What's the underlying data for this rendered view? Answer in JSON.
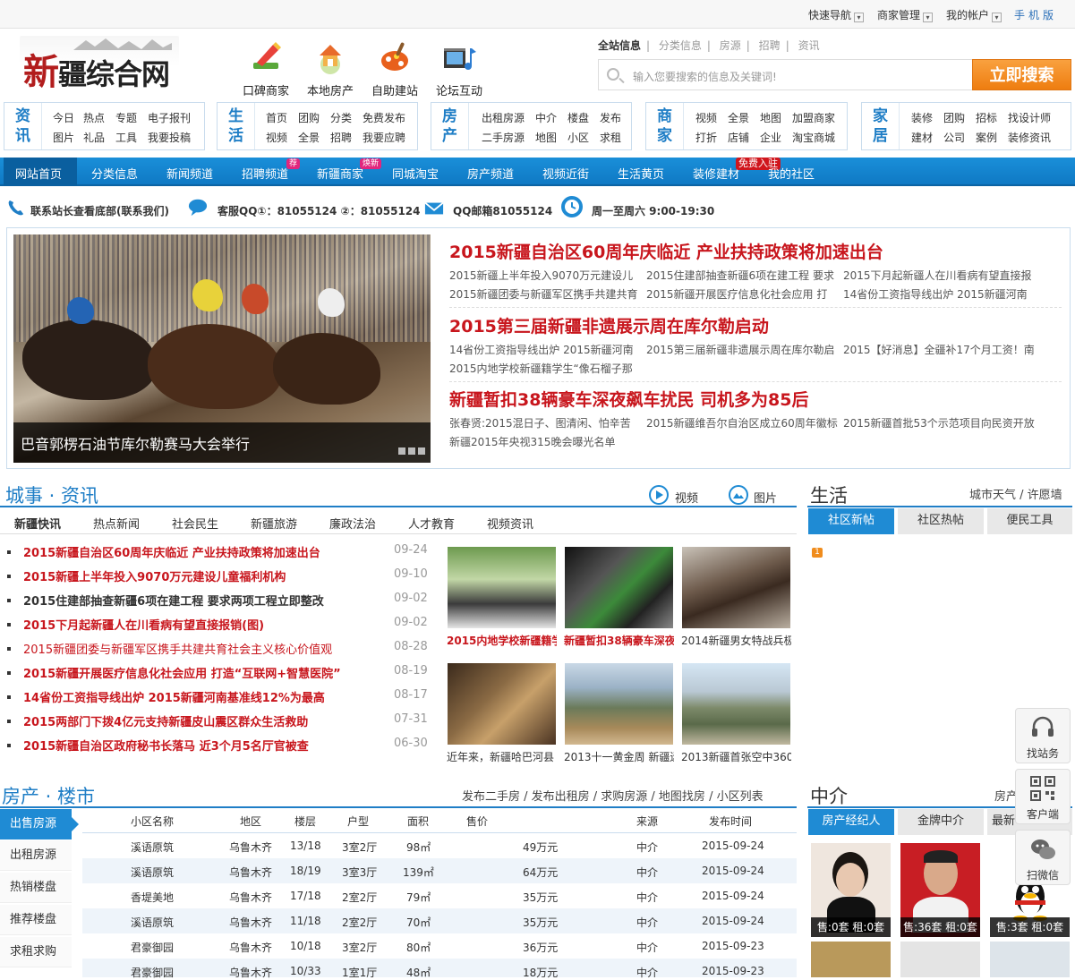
{
  "topbar": {
    "quicknav": "快速导航",
    "merchant": "商家管理",
    "account": "我的帐户",
    "mobile": "手机版"
  },
  "logo": {
    "text_big": "新",
    "text_rest": "疆综合网"
  },
  "header_icons": [
    {
      "label": "口碑商家"
    },
    {
      "label": "本地房产"
    },
    {
      "label": "自助建站"
    },
    {
      "label": "论坛互动"
    }
  ],
  "search": {
    "tabs": [
      "全站信息",
      "分类信息",
      "房源",
      "招聘",
      "资讯"
    ],
    "placeholder": "输入您要搜索的信息及关键词!",
    "button": "立即搜索"
  },
  "categories": [
    {
      "title1": "资",
      "title2": "讯",
      "links": [
        "今日",
        "热点",
        "专题",
        "电子报刊",
        "图片",
        "礼品",
        "工具",
        "我要投稿"
      ]
    },
    {
      "title1": "生",
      "title2": "活",
      "links": [
        "首页",
        "团购",
        "分类",
        "免费发布",
        "视频",
        "全景",
        "招聘",
        "我要应聘"
      ]
    },
    {
      "title1": "房",
      "title2": "产",
      "links": [
        "出租房源",
        "中介",
        "楼盘",
        "发布",
        "二手房源",
        "地图",
        "小区",
        "求租"
      ]
    },
    {
      "title1": "商",
      "title2": "家",
      "links": [
        "视频",
        "全景",
        "地图",
        "加盟商家",
        "打折",
        "店铺",
        "企业",
        "淘宝商城"
      ]
    },
    {
      "title1": "家",
      "title2": "居",
      "links": [
        "装修",
        "团购",
        "招标",
        "找设计师",
        "建材",
        "公司",
        "案例",
        "装修资讯"
      ]
    }
  ],
  "nav": {
    "items": [
      "网站首页",
      "分类信息",
      "新闻频道",
      "招聘频道",
      "新疆商家",
      "同城淘宝",
      "房产频道",
      "视频近街",
      "生活黄页",
      "装修建材",
      "我的社区"
    ],
    "tags": {
      "recommend": "荐",
      "new": "焕新",
      "free": "免费入驻"
    }
  },
  "contact": {
    "stationmaster": "联系站长查看底部(联系我们)",
    "qq": "客服QQ①：81055124 ②：81055124",
    "mail": "QQ邮箱81055124",
    "hours": "周一至周六 9:00-19:30"
  },
  "slider": {
    "caption": "巴音郭楞石油节库尔勒赛马大会举行"
  },
  "headlines": [
    {
      "title": "2015新疆自治区60周年庆临近 产业扶持政策将加速出台",
      "subs": [
        "2015新疆上半年投入9070万元建设儿",
        "2015住建部抽查新疆6项在建工程 要求",
        "2015下月起新疆人在川看病有望直接报",
        "2015新疆团委与新疆军区携手共建共育",
        "2015新疆开展医疗信息化社会应用 打",
        "14省份工资指导线出炉 2015新疆河南"
      ]
    },
    {
      "title": "2015第三届新疆非遗展示周在库尔勒启动",
      "subs": [
        "14省份工资指导线出炉 2015新疆河南",
        "2015第三届新疆非遗展示周在库尔勒启",
        "2015【好消息】全疆补17个月工资！南",
        "2015内地学校新疆籍学生“像石榴子那"
      ]
    },
    {
      "title": "新疆暂扣38辆豪车深夜飙车扰民 司机多为85后",
      "subs": [
        "张春贤:2015混日子、图清闲、怕辛苦",
        "2015新疆维吾尔自治区成立60周年徽标",
        "2015新疆首批53个示范项目向民资开放",
        "新疆2015年央视315晚会曝光名单"
      ]
    }
  ],
  "news_section": {
    "title": "城事 · 资讯",
    "video": "视频",
    "photo": "图片",
    "tabs": [
      "新疆快讯",
      "热点新闻",
      "社会民生",
      "新疆旅游",
      "廉政法治",
      "人才教育",
      "视频资讯"
    ],
    "items": [
      {
        "text": "2015新疆自治区60周年庆临近 产业扶持政策将加速出台",
        "date": "09-24"
      },
      {
        "text": "2015新疆上半年投入9070万元建设儿童福利机构",
        "date": "09-10"
      },
      {
        "text": "2015住建部抽查新疆6项在建工程 要求两项工程立即整改",
        "date": "09-02"
      },
      {
        "text": "2015下月起新疆人在川看病有望直接报销(图)",
        "date": "09-02"
      },
      {
        "text": "2015新疆团委与新疆军区携手共建共育社会主义核心价值观",
        "date": "08-28"
      },
      {
        "text": "2015新疆开展医疗信息化社会应用 打造“互联网+智慧医院”",
        "date": "08-19"
      },
      {
        "text": "14省份工资指导线出炉 2015新疆河南基准线12%为最高",
        "date": "08-17"
      },
      {
        "text": "2015两部门下拨4亿元支持新疆皮山震区群众生活救助",
        "date": "07-31"
      },
      {
        "text": "2015新疆自治区政府秘书长落马 近3个月5名厅官被查",
        "date": "06-30"
      }
    ],
    "thumbs": [
      "2015内地学校新疆籍学",
      "新疆暂扣38辆豪车深夜",
      "2014新疆男女特战兵极",
      "近年来，新疆哈巴河县",
      "2013十一黄金周 新疆迷",
      "2013新疆首张空中360"
    ]
  },
  "life": {
    "title": "生活",
    "links": "城市天气 / 许愿墙",
    "tabs": [
      "社区新帖",
      "社区热帖",
      "便民工具"
    ],
    "badge": "1"
  },
  "property": {
    "title": "房产 · 楼市",
    "links": "发布二手房 / 发布出租房 / 求购房源 / 地图找房 / 小区列表",
    "side_tabs": [
      "出售房源",
      "出租房源",
      "热销楼盘",
      "推荐楼盘",
      "求租求购"
    ],
    "headers": [
      "小区名称",
      "地区",
      "楼层",
      "户型",
      "面积",
      "售价",
      "来源",
      "发布时间"
    ],
    "rows": [
      [
        "溪语原筑",
        "乌鲁木齐",
        "13/18",
        "3室2厅",
        "98㎡",
        "49万元",
        "中介",
        "2015-09-24"
      ],
      [
        "溪语原筑",
        "乌鲁木齐",
        "18/19",
        "3室3厅",
        "139㎡",
        "64万元",
        "中介",
        "2015-09-24"
      ],
      [
        "香堤美地",
        "乌鲁木齐",
        "17/18",
        "2室2厅",
        "79㎡",
        "35万元",
        "中介",
        "2015-09-24"
      ],
      [
        "溪语原筑",
        "乌鲁木齐",
        "11/18",
        "2室2厅",
        "70㎡",
        "35万元",
        "中介",
        "2015-09-24"
      ],
      [
        "君豪御园",
        "乌鲁木齐",
        "10/18",
        "3室2厅",
        "80㎡",
        "36万元",
        "中介",
        "2015-09-23"
      ],
      [
        "君豪御园",
        "乌鲁木齐",
        "10/33",
        "1室1厅",
        "48㎡",
        "18万元",
        "中介",
        "2015-09-23"
      ]
    ]
  },
  "agency": {
    "title": "中介",
    "link": "房产",
    "tabs": [
      "房产经纪人",
      "金牌中介",
      "最新"
    ],
    "agents": [
      {
        "label": "售:0套 租:0套"
      },
      {
        "label": "售:36套 租:0套"
      },
      {
        "label": "售:3套 租:0套"
      }
    ]
  },
  "floating": [
    "找站务",
    "客户端",
    "扫微信"
  ]
}
